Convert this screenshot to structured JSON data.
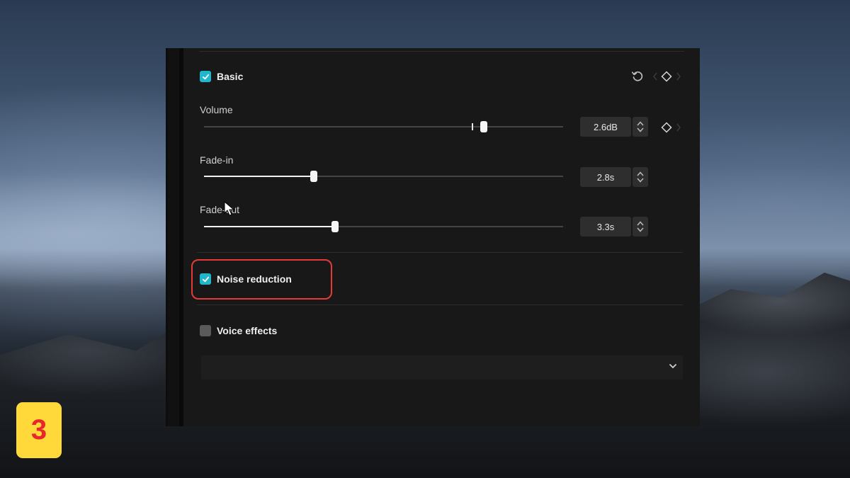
{
  "panel": {
    "basic": {
      "title": "Basic",
      "checked": true
    },
    "volume": {
      "label": "Volume",
      "value": "2.6dB",
      "level": 0.78
    },
    "fade_in": {
      "label": "Fade-in",
      "value": "2.8s",
      "level": 0.305
    },
    "fade_out": {
      "label": "Fade-out",
      "value": "3.3s",
      "level": 0.365
    },
    "noise_reduction": {
      "title": "Noise reduction",
      "checked": true
    },
    "voice_effects": {
      "title": "Voice effects",
      "checked": false
    },
    "dropdown_value": ""
  },
  "icons": {
    "reset": "reset-icon",
    "keyframe": "keyframe-diamond-icon",
    "stepper": "up-down-arrows-icon",
    "chevron": "chevron-down-icon",
    "cursor": "mouse-pointer-icon"
  },
  "colors": {
    "accent": "#21b6c9",
    "highlight": "#e53a3a",
    "badge_bg": "#ffd93a",
    "badge_text": "#e8262b"
  },
  "badge": {
    "step": "3"
  }
}
